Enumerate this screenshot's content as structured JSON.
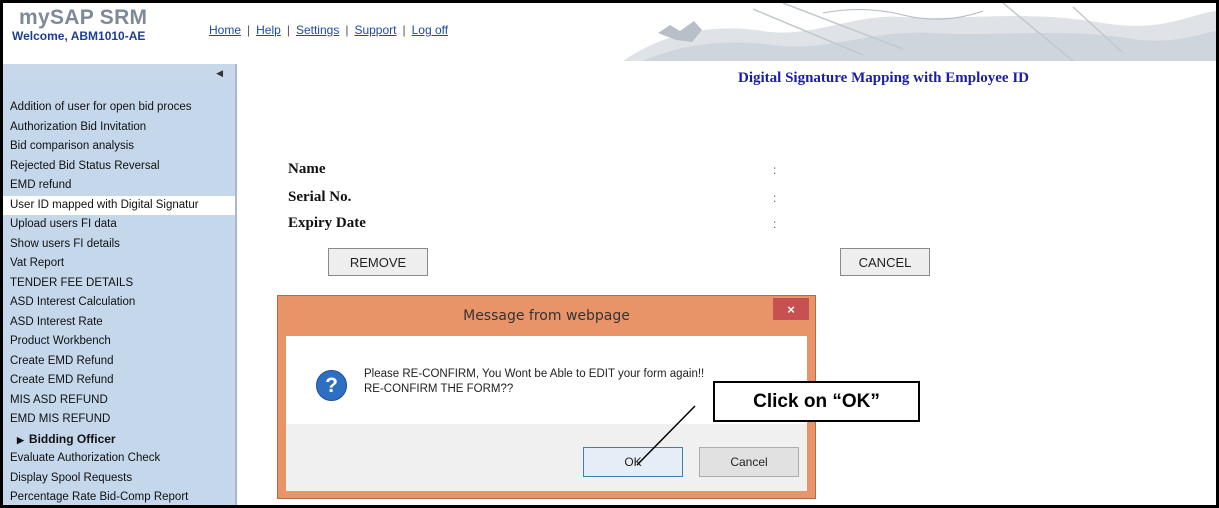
{
  "header": {
    "logo": "mySAP SRM",
    "welcome": "Welcome, ABM1010-AE",
    "nav": [
      "Home",
      "Help",
      "Settings",
      "Support",
      "Log off"
    ]
  },
  "sidebar": {
    "items": [
      {
        "label": "Addition of user for open bid proces",
        "type": "item"
      },
      {
        "label": "Authorization Bid Invitation",
        "type": "item"
      },
      {
        "label": "Bid comparison analysis",
        "type": "item"
      },
      {
        "label": "Rejected Bid Status Reversal",
        "type": "item"
      },
      {
        "label": "EMD refund",
        "type": "item"
      },
      {
        "label": "User ID mapped with Digital Signatur",
        "type": "selected"
      },
      {
        "label": "Upload users FI data",
        "type": "item"
      },
      {
        "label": "Show users FI details",
        "type": "item"
      },
      {
        "label": "Vat Report",
        "type": "item"
      },
      {
        "label": "TENDER FEE DETAILS",
        "type": "item"
      },
      {
        "label": "ASD Interest Calculation",
        "type": "item"
      },
      {
        "label": "ASD Interest Rate",
        "type": "item"
      },
      {
        "label": "Product Workbench",
        "type": "item"
      },
      {
        "label": "Create EMD Refund",
        "type": "item"
      },
      {
        "label": "Create EMD Refund",
        "type": "item"
      },
      {
        "label": "MIS ASD REFUND",
        "type": "item"
      },
      {
        "label": "EMD MIS REFUND",
        "type": "item"
      },
      {
        "label": "Bidding Officer",
        "type": "section"
      },
      {
        "label": "Evaluate Authorization Check",
        "type": "item"
      },
      {
        "label": "Display Spool Requests",
        "type": "item"
      },
      {
        "label": "Percentage Rate Bid-Comp Report",
        "type": "item"
      }
    ]
  },
  "main": {
    "title": "Digital Signature Mapping with Employee ID",
    "fields": [
      {
        "label": "Name",
        "colon": ":"
      },
      {
        "label": "Serial No.",
        "colon": ":"
      },
      {
        "label": "Expiry Date",
        "colon": ":"
      }
    ],
    "remove_label": "REMOVE",
    "cancel_label": "CANCEL"
  },
  "dialog": {
    "title": "Message from webpage",
    "close_label": "×",
    "icon_label": "?",
    "message_line1": "Please RE-CONFIRM, You Wont be Able to EDIT your form again!!",
    "message_line2": "RE-CONFIRM THE FORM??",
    "ok_label": "OK",
    "cancel_label": "Cancel"
  },
  "callout": {
    "text": "Click on “OK”"
  }
}
